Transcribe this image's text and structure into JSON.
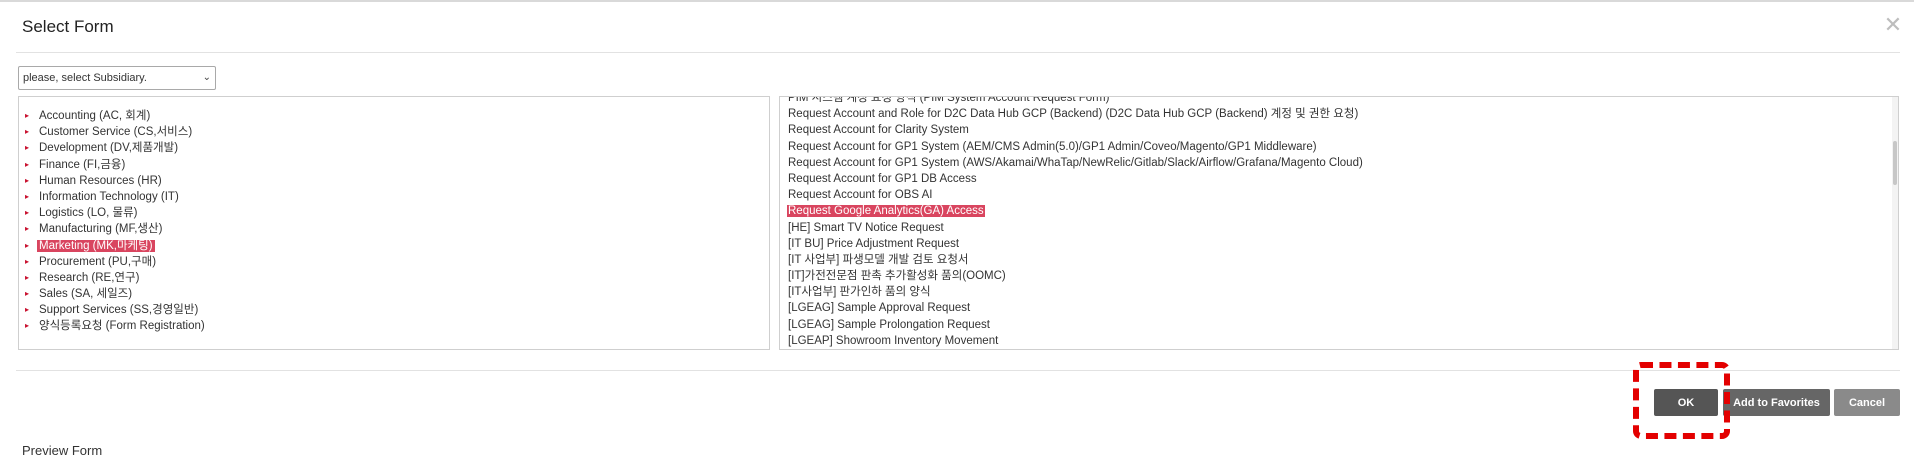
{
  "dialog": {
    "title": "Select Form"
  },
  "subsidiary": {
    "selected": "please, select Subsidiary."
  },
  "categories": [
    {
      "label": "Accounting (AC, 회계)"
    },
    {
      "label": "Customer Service (CS,서비스)"
    },
    {
      "label": "Development (DV,제품개발)"
    },
    {
      "label": "Finance (FI,금융)"
    },
    {
      "label": "Human Resources (HR)"
    },
    {
      "label": "Information Technology (IT)"
    },
    {
      "label": "Logistics (LO, 물류)"
    },
    {
      "label": "Manufacturing (MF,생산)"
    },
    {
      "label": "Marketing (MK,마케팅)",
      "selected": true
    },
    {
      "label": "Procurement (PU,구매)"
    },
    {
      "label": "Research (RE,연구)"
    },
    {
      "label": "Sales (SA, 세일즈)"
    },
    {
      "label": "Support Services (SS,경영일반)"
    },
    {
      "label": "양식등록요청 (Form Registration)"
    }
  ],
  "forms": [
    {
      "label": "PIM 시스템 계정 요청 양식 (PIM System Account Request Form)"
    },
    {
      "label": "Request Account and Role for D2C Data Hub GCP (Backend) (D2C Data Hub GCP (Backend) 계정 및 권한 요청)"
    },
    {
      "label": "Request Account for Clarity System"
    },
    {
      "label": "Request Account for GP1 System (AEM/CMS Admin(5.0)/GP1 Admin/Coveo/Magento/GP1 Middleware)"
    },
    {
      "label": "Request Account for GP1 System (AWS/Akamai/WhaTap/NewRelic/Gitlab/Slack/Airflow/Grafana/Magento Cloud)"
    },
    {
      "label": "Request Account for GP1 DB Access"
    },
    {
      "label": "Request Account for OBS AI"
    },
    {
      "label": "Request Google Analytics(GA) Access",
      "selected": true
    },
    {
      "label": "[HE] Smart TV Notice Request"
    },
    {
      "label": "[IT BU] Price Adjustment Request"
    },
    {
      "label": "[IT 사업부] 파생모델 개발 검토 요청서"
    },
    {
      "label": "[IT]가전전문점 판촉 추가활성화 품의(OOMC)"
    },
    {
      "label": "[IT사업부] 판가인하 품의 양식"
    },
    {
      "label": "[LGEAG] Sample Approval Request"
    },
    {
      "label": "[LGEAG] Sample Prolongation Request"
    },
    {
      "label": "[LGEAP] Showroom Inventory Movement"
    }
  ],
  "buttons": {
    "ok": "OK",
    "favorites": "Add to Favorites",
    "cancel": "Cancel"
  },
  "preview": {
    "label": "Preview Form"
  },
  "colors": {
    "selection": "#d9455f",
    "arrow": "#c8102e",
    "highlight": "#e30000",
    "ok_button": "#555555"
  },
  "icons": {
    "close": "close-icon",
    "dropdown": "chevron-down-icon",
    "bullet": "triangle-right-icon"
  }
}
